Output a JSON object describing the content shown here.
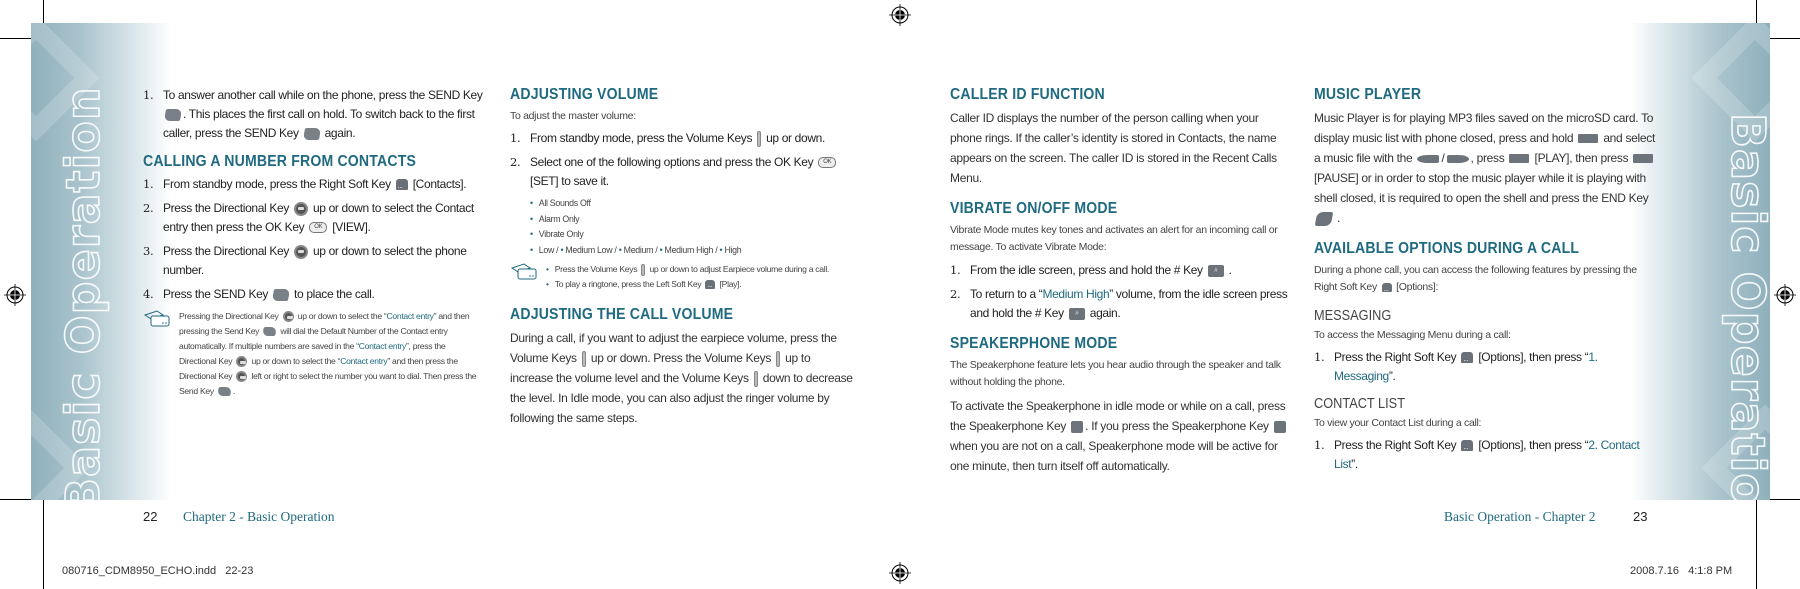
{
  "left_page": {
    "band_title": "Basic Operation",
    "col1": {
      "intro_step": {
        "num": "1.",
        "parts": [
          "To answer another call while on the phone, press the SEND Key",
          ". This places the first call on hold. To switch back to the first caller, press the SEND Key",
          "again."
        ]
      },
      "section": {
        "heading": "CALLING A NUMBER FROM CONTACTS",
        "steps": [
          {
            "num": "1.",
            "a": "From standby mode, press the Right Soft Key",
            "b": "[Contacts]."
          },
          {
            "num": "2.",
            "a": "Press the Directional Key",
            "b": "up or down to select the Contact entry then press the OK Key",
            "c": "[VIEW]."
          },
          {
            "num": "3.",
            "a": "Press the Directional Key",
            "b": "up or down to select the phone number."
          },
          {
            "num": "4.",
            "a": "Press the SEND Key",
            "b": "to place the call."
          }
        ],
        "note": {
          "p1": "Pressing the Directional Key",
          "p2": "up or down to select the “",
          "link1": "Contact entry",
          "p3": "” and then pressing the Send Key",
          "p4": "will dial the Default Number of the Contact entry automatically. If multiple numbers are saved in the “",
          "link2": "Contact entry",
          "p5": "”, press the Directional Key",
          "p6": "up or down to select the “",
          "link3": "Contact entry",
          "p7": "” and then press the Directional Key",
          "p8": "left or right to select the number you want to dial. Then press the Send Key",
          "p9": "."
        }
      }
    },
    "col2": {
      "adjusting_volume": {
        "heading": "ADJUSTING VOLUME",
        "intro": "To adjust the master volume:",
        "steps": [
          {
            "num": "1.",
            "a": "From standby mode, press the Volume Keys",
            "b": "up or down."
          },
          {
            "num": "2.",
            "a": "Select one of the following options and press the OK Key",
            "b": "[SET] to save it."
          }
        ],
        "options": [
          "All Sounds Off",
          "Alarm Only",
          "Vibrate Only"
        ],
        "levels": [
          "Low /",
          "Medium Low /",
          "Medium /",
          "Medium High /",
          "High"
        ],
        "notes": [
          {
            "a": "Press the Volume Keys",
            "b": "up or down to adjust Earpiece volume during a call."
          },
          {
            "a": "To play a ringtone, press the Left Soft Key",
            "b": "[Play]."
          }
        ]
      },
      "call_volume": {
        "heading": "ADJUSTING THE CALL VOLUME",
        "p1": "During a call, if you want to adjust the earpiece volume, press the Volume Keys",
        "p2": "up or down. Press the Volume Keys",
        "p3": "up to increase the volume level and the Volume Keys",
        "p4": "down to decrease the level. In Idle mode, you can also adjust the ringer volume by following the same steps."
      }
    },
    "footer": {
      "page_number": "22",
      "running_head": "Chapter 2 - Basic Operation"
    }
  },
  "right_page": {
    "band_title": "Basic Operation",
    "col3": {
      "caller_id": {
        "heading": "CALLER ID FUNCTION",
        "body": "Caller ID displays the number of the person calling when your phone rings. If the caller’s identity is stored in Contacts, the name appears on the screen. The caller ID is stored in the Recent Calls Menu."
      },
      "vibrate": {
        "heading": "VIBRATE ON/OFF MODE",
        "intro": "Vibrate Mode mutes key tones and activates an alert for an incoming call or message. To activate Vibrate Mode:",
        "steps": [
          {
            "num": "1.",
            "a": "From the idle screen, press and hold the # Key",
            "b": "."
          },
          {
            "num": "2.",
            "a": "To return to a “",
            "link": "Medium High",
            "b": "” volume, from the idle screen press and hold the # Key",
            "c": "again."
          }
        ]
      },
      "speakerphone": {
        "heading": "SPEAKERPHONE MODE",
        "intro": "The Speakerphone feature lets you hear audio through the speaker and talk without holding the phone.",
        "p1": "To activate the Speakerphone in idle mode or while on a call, press the Speakerphone Key",
        "p2": ". If you press the Speakerphone Key",
        "p3": "when you are not on a call, Speakerphone mode will be active for one minute, then turn itself off automatically."
      }
    },
    "col4": {
      "music_player": {
        "heading": "MUSIC PLAYER",
        "p1": "Music Player is for playing MP3 files saved on the microSD card. To display music list with phone closed, press and hold",
        "p2": "and select a music file with the",
        "p3": "/",
        "p4": ", press",
        "p5": "[PLAY], then press",
        "p6": "[PAUSE] or in order to stop the music player while it is playing with shell closed, it is required to open the shell and press the END Key",
        "p7": "."
      },
      "options": {
        "heading": "AVAILABLE OPTIONS DURING A CALL",
        "a": "During a phone call, you can access the following features by pressing the Right Soft Key",
        "b": "[Options]:"
      },
      "messaging": {
        "heading": "MESSAGING",
        "intro": "To access the Messaging Menu during a call:",
        "step": {
          "num": "1.",
          "a": "Press the Right Soft Key",
          "b": "[Options], then press “",
          "link": "1. Messaging",
          "c": "”."
        }
      },
      "contact_list": {
        "heading": "CONTACT LIST",
        "intro": "To view your Contact List during a call:",
        "step": {
          "num": "1.",
          "a": "Press the Right Soft Key",
          "b": "[Options], then press “",
          "link": "2. Contact List",
          "c": "”."
        }
      }
    },
    "footer": {
      "page_number": "23",
      "running_head": "Basic Operation - Chapter 2"
    }
  },
  "slug": {
    "file": "080716_CDM8950_ECHO.indd   22-23",
    "date": "2008.7.16   4:1:8 PM"
  },
  "colors": {
    "accent": "#1f6a80",
    "band": "#8fb0bc"
  }
}
